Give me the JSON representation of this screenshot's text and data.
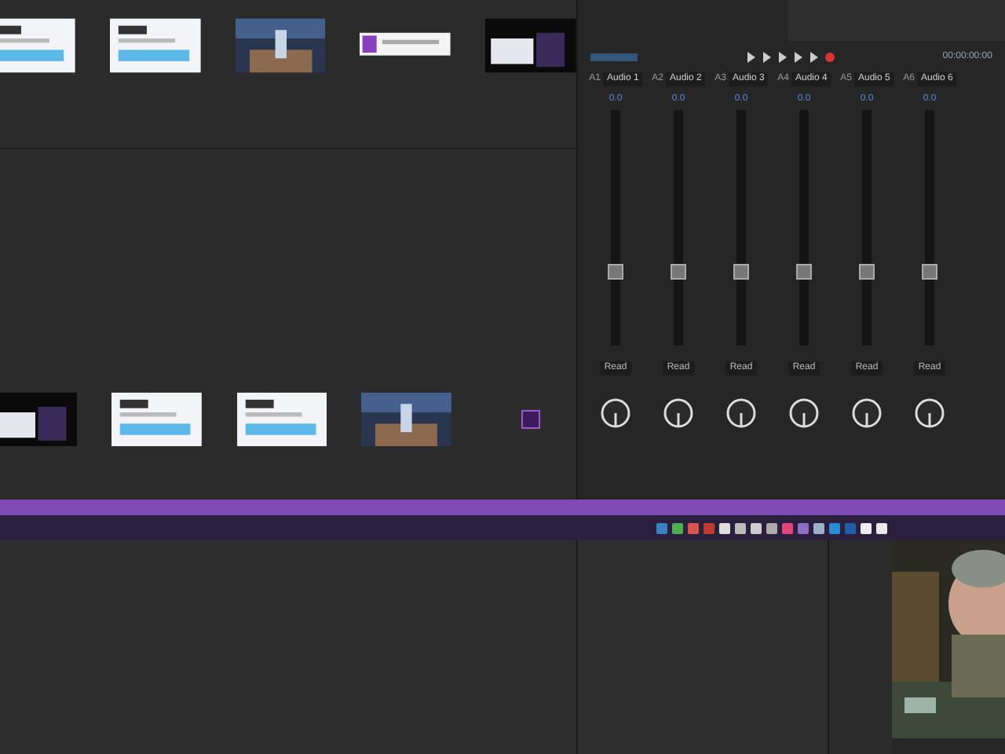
{
  "project_bin": {
    "top_clips": [
      {
        "kind": "webpage"
      },
      {
        "kind": "webpage"
      },
      {
        "kind": "picture"
      },
      {
        "kind": "banner"
      },
      {
        "kind": "dark"
      }
    ],
    "bottom_clips": [
      {
        "kind": "dark"
      },
      {
        "kind": "webpage"
      },
      {
        "kind": "webpage"
      },
      {
        "kind": "picture"
      },
      {
        "kind": "app"
      }
    ]
  },
  "mixer": {
    "timecode": "00:00:00:00",
    "tracks": [
      {
        "id": "A1",
        "name": "Audio 1",
        "pan": "0.0",
        "automation": "Read",
        "level": 0.3
      },
      {
        "id": "A2",
        "name": "Audio 2",
        "pan": "0.0",
        "automation": "Read",
        "level": 0.3
      },
      {
        "id": "A3",
        "name": "Audio 3",
        "pan": "0.0",
        "automation": "Read",
        "level": 0.3
      },
      {
        "id": "A4",
        "name": "Audio 4",
        "pan": "0.0",
        "automation": "Read",
        "level": 0.3
      },
      {
        "id": "A5",
        "name": "Audio 5",
        "pan": "0.0",
        "automation": "Read",
        "level": 0.3
      },
      {
        "id": "A6",
        "name": "Audio 6",
        "pan": "0.0",
        "automation": "Read",
        "level": 0.3
      }
    ]
  },
  "taskbar": {
    "icons": [
      {
        "color": "#3b82c4"
      },
      {
        "color": "#4caf50"
      },
      {
        "color": "#d9534f"
      },
      {
        "color": "#c0392b"
      },
      {
        "color": "#dddddd"
      },
      {
        "color": "#bbbbbb"
      },
      {
        "color": "#cccccc"
      },
      {
        "color": "#aaaaaa"
      },
      {
        "color": "#e0457b"
      },
      {
        "color": "#8e6fc4"
      },
      {
        "color": "#9bb0c8"
      },
      {
        "color": "#2a8ad4"
      },
      {
        "color": "#1e5fa8"
      },
      {
        "color": "#eeeeee"
      },
      {
        "color": "#e8e8e8"
      }
    ]
  },
  "webcam": {
    "kind": "picture"
  }
}
